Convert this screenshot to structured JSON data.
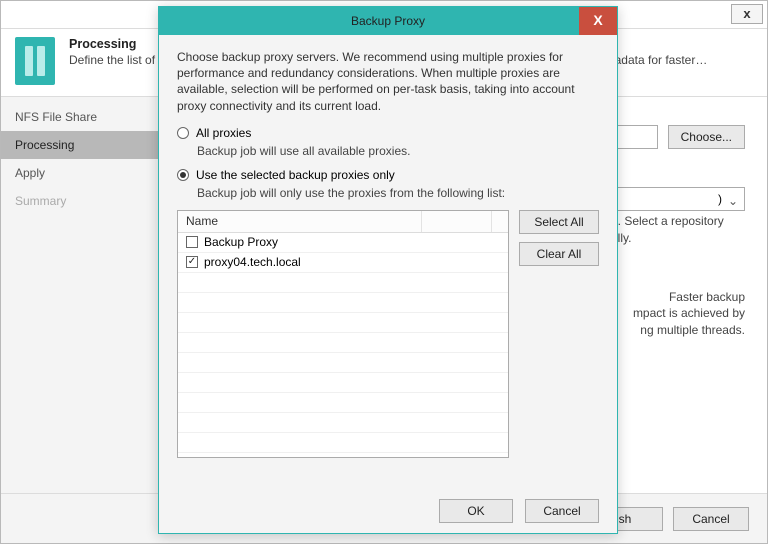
{
  "parent": {
    "close_x": "x",
    "header_title": "Processing",
    "header_sub": "Define the list of backup proxies to perform the backup, then specify backup repository to store the metadata for faster backup",
    "nav": {
      "items": [
        "NFS File Share",
        "Processing",
        "Apply",
        "Summary"
      ],
      "selected_index": 1
    },
    "choose_btn": "Choose...",
    "drop_suffix": ")",
    "repo_desc": "d. Select a repository",
    "repo_desc2": "ally.",
    "perf_line1": "Faster backup",
    "perf_line2": "mpact is achieved by",
    "perf_line3": "ng multiple threads.",
    "footer": {
      "finish": "sh",
      "cancel": "Cancel"
    }
  },
  "modal": {
    "title": "Backup Proxy",
    "close_x": "X",
    "intro": "Choose backup proxy servers. We recommend using multiple proxies for performance and redundancy considerations. When multiple proxies are available, selection will be performed on per-task basis, taking into account proxy connectivity and its current load.",
    "opt_all_label": "All proxies",
    "opt_all_hint": "Backup job will use all available proxies.",
    "opt_sel_label": "Use the selected backup proxies only",
    "opt_sel_hint": "Backup job will only use the proxies from the following list:",
    "selected_option": 1,
    "table": {
      "col_name": "Name",
      "rows": [
        {
          "label": "Backup Proxy",
          "checked": false
        },
        {
          "label": "proxy04.tech.local",
          "checked": true
        }
      ]
    },
    "select_all": "Select All",
    "clear_all": "Clear All",
    "ok": "OK",
    "cancel": "Cancel"
  }
}
